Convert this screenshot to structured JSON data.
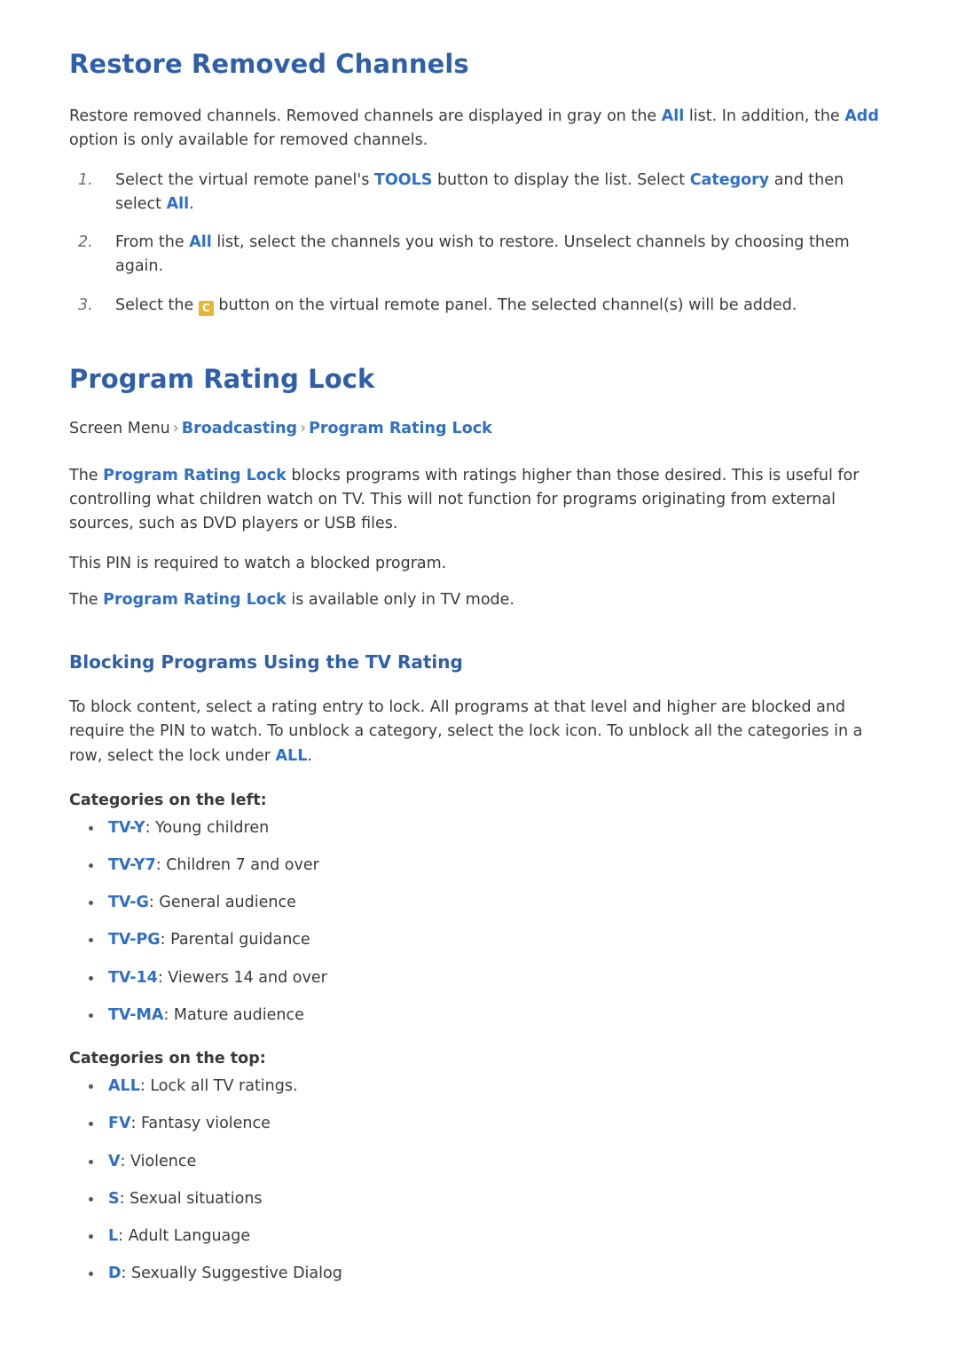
{
  "colors": {
    "heading_blue": "#2f5fa8",
    "link_blue": "#2f6fc4",
    "body_text": "#3a3a3a",
    "c_key_yellow": "#e8b530"
  },
  "sections": [
    {
      "title": "Restore Removed Channels",
      "intro_parts": [
        {
          "t": "Restore removed channels. Removed channels are displayed in gray on the ",
          "s": "plain"
        },
        {
          "t": "All",
          "s": "blue"
        },
        {
          "t": " list. In addition, the ",
          "s": "plain"
        },
        {
          "t": "Add",
          "s": "blue"
        },
        {
          "t": " option is only available for removed channels.",
          "s": "plain"
        }
      ],
      "steps": [
        {
          "num": "1.",
          "parts": [
            {
              "t": "Select the virtual remote panel's ",
              "s": "plain"
            },
            {
              "t": "TOOLS",
              "s": "blue"
            },
            {
              "t": " button to display the list. Select ",
              "s": "plain"
            },
            {
              "t": "Category",
              "s": "blue"
            },
            {
              "t": " and then select ",
              "s": "plain"
            },
            {
              "t": "All",
              "s": "blue"
            },
            {
              "t": ".",
              "s": "plain"
            }
          ]
        },
        {
          "num": "2.",
          "parts": [
            {
              "t": "From the ",
              "s": "plain"
            },
            {
              "t": "All",
              "s": "blue"
            },
            {
              "t": " list, select the channels you wish to restore. Unselect channels by choosing them again.",
              "s": "plain"
            }
          ]
        },
        {
          "num": "3.",
          "parts": [
            {
              "t": "Select the ",
              "s": "plain"
            },
            {
              "t": "C",
              "s": "ckey"
            },
            {
              "t": " button on the virtual remote panel. The selected channel(s) will be added.",
              "s": "plain"
            }
          ]
        }
      ]
    }
  ],
  "restore": {
    "title": "Restore Removed Channels",
    "intro_a": "Restore removed channels. Removed channels are displayed in gray on the ",
    "intro_all": "All",
    "intro_b": " list. In addition, the ",
    "intro_add": "Add",
    "intro_c": " option is only available for removed channels.",
    "step1_num": "1.",
    "step1_a": "Select the virtual remote panel's ",
    "step1_tools": "TOOLS",
    "step1_b": " button to display the list. Select ",
    "step1_category": "Category",
    "step1_c": " and then select ",
    "step1_all": "All",
    "step1_d": ".",
    "step2_num": "2.",
    "step2_a": "From the ",
    "step2_all": "All",
    "step2_b": " list, select the channels you wish to restore. Unselect channels by choosing them again.",
    "step3_num": "3.",
    "step3_a": "Select the ",
    "step3_ckey": "C",
    "step3_b": " button on the virtual remote panel. The selected channel(s) will be added."
  },
  "rating_lock": {
    "title": "Program Rating Lock",
    "menu_path": {
      "root": "Screen Menu",
      "sep1": "›",
      "item1": "Broadcasting",
      "sep2": "›",
      "item2": "Program Rating Lock"
    },
    "p1_a": "The ",
    "p1_link": "Program Rating Lock",
    "p1_b": " blocks programs with ratings higher than those desired. This is useful for controlling what children watch on TV. This will not function for programs originating from external sources, such as DVD players or USB files.",
    "p2": "This PIN is required to watch a blocked program.",
    "p3_a": "The ",
    "p3_link": "Program Rating Lock",
    "p3_b": " is available only in TV mode."
  },
  "blocking": {
    "subtitle": "Blocking Programs Using the TV Rating",
    "intro_a": "To block content, select a rating entry to lock. All programs at that level and higher are blocked and require the PIN to watch. To unblock a category, select the lock icon. To unblock all the categories in a row, select the lock under ",
    "intro_all": "ALL",
    "intro_b": ".",
    "left_heading": "Categories on the left:",
    "left_items": [
      {
        "code": "TV-Y",
        "desc": ": Young children"
      },
      {
        "code": "TV-Y7",
        "desc": ": Children 7 and over"
      },
      {
        "code": "TV-G",
        "desc": ": General audience"
      },
      {
        "code": "TV-PG",
        "desc": ": Parental guidance"
      },
      {
        "code": "TV-14",
        "desc": ": Viewers 14 and over"
      },
      {
        "code": "TV-MA",
        "desc": ": Mature audience"
      }
    ],
    "top_heading": "Categories on the top:",
    "top_items": [
      {
        "code": "ALL",
        "desc": ": Lock all TV ratings."
      },
      {
        "code": "FV",
        "desc": ": Fantasy violence"
      },
      {
        "code": "V",
        "desc": ": Violence"
      },
      {
        "code": "S",
        "desc": ": Sexual situations"
      },
      {
        "code": "L",
        "desc": ": Adult Language"
      },
      {
        "code": "D",
        "desc": ": Sexually Suggestive Dialog"
      }
    ]
  }
}
